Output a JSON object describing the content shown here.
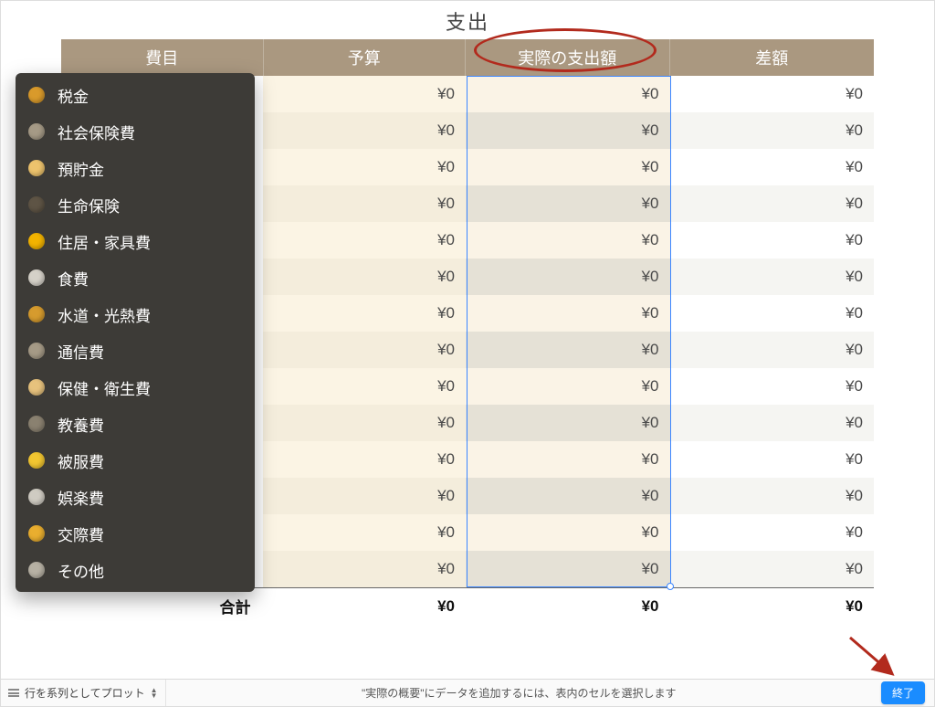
{
  "title": "支出",
  "headers": {
    "c0": "費目",
    "c1": "予算",
    "c2": "実際の支出額",
    "c3": "差額"
  },
  "totals_label": "合計",
  "totals": {
    "c1": "¥0",
    "c2": "¥0",
    "c3": "¥0"
  },
  "categories": [
    {
      "label": "税金",
      "color": "#d99a2b",
      "c1": "¥0",
      "c2": "¥0",
      "c3": "¥0"
    },
    {
      "label": "社会保険費",
      "color": "#a59a86",
      "c1": "¥0",
      "c2": "¥0",
      "c3": "¥0"
    },
    {
      "label": "預貯金",
      "color": "#edc36d",
      "c1": "¥0",
      "c2": "¥0",
      "c3": "¥0"
    },
    {
      "label": "生命保険",
      "color": "#5e5445",
      "c1": "¥0",
      "c2": "¥0",
      "c3": "¥0"
    },
    {
      "label": "住居・家具費",
      "color": "#f2b300",
      "c1": "¥0",
      "c2": "¥0",
      "c3": "¥0"
    },
    {
      "label": "食費",
      "color": "#d5d1c8",
      "c1": "¥0",
      "c2": "¥0",
      "c3": "¥0"
    },
    {
      "label": "水道・光熱費",
      "color": "#d69b2e",
      "c1": "¥0",
      "c2": "¥0",
      "c3": "¥0"
    },
    {
      "label": "通信費",
      "color": "#a59a86",
      "c1": "¥0",
      "c2": "¥0",
      "c3": "¥0"
    },
    {
      "label": "保健・衛生費",
      "color": "#e7c27d",
      "c1": "¥0",
      "c2": "¥0",
      "c3": "¥0"
    },
    {
      "label": "教養費",
      "color": "#8a8170",
      "c1": "¥0",
      "c2": "¥0",
      "c3": "¥0"
    },
    {
      "label": "被服費",
      "color": "#f2c631",
      "c1": "¥0",
      "c2": "¥0",
      "c3": "¥0"
    },
    {
      "label": "娯楽費",
      "color": "#cfcbc2",
      "c1": "¥0",
      "c2": "¥0",
      "c3": "¥0"
    },
    {
      "label": "交際費",
      "color": "#e9ae2f",
      "c1": "¥0",
      "c2": "¥0",
      "c3": "¥0"
    },
    {
      "label": "その他",
      "color": "#b7b1a4",
      "c1": "¥0",
      "c2": "¥0",
      "c3": "¥0"
    }
  ],
  "toolbar": {
    "plot_label": "行を系列としてプロット",
    "hint": "\"実際の概要\"にデータを追加するには、表内のセルを選択します",
    "done": "終了"
  }
}
